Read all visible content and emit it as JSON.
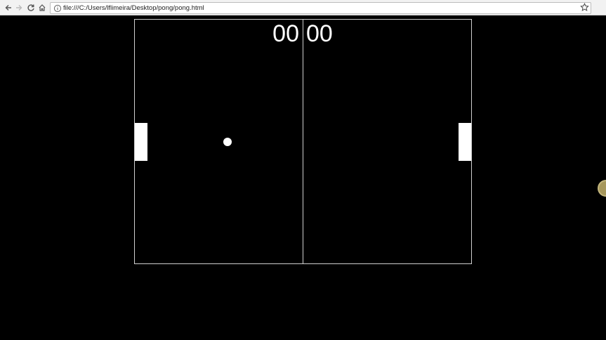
{
  "browser": {
    "url": "file:///C:/Users/lflimeira/Desktop/pong/pong.html",
    "icons": {
      "back": "back-arrow-icon",
      "forward": "forward-arrow-icon",
      "reload": "reload-icon",
      "home": "home-icon",
      "info": "info-icon",
      "bookmark": "star-icon"
    }
  },
  "game": {
    "score_left": "00",
    "score_right": "00",
    "colors": {
      "background": "#000000",
      "foreground": "#ffffff",
      "lines": "#cfcfcf"
    }
  }
}
